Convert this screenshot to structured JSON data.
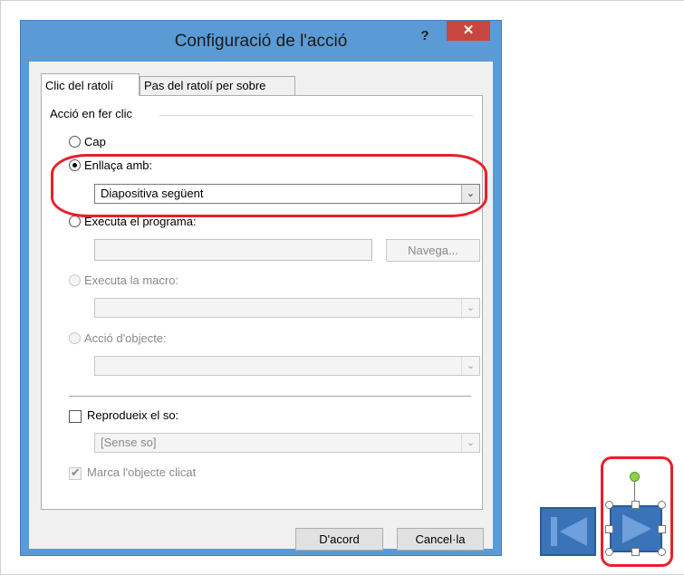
{
  "dialog": {
    "title": "Configuració de l'acció",
    "help_label": "?",
    "close_label": "✕",
    "tabs": [
      {
        "label": "Clic del ratolí"
      },
      {
        "label": "Pas del ratolí per sobre"
      }
    ],
    "group_label": "Acció en fer clic",
    "options": {
      "none": "Cap",
      "link": "Enllaça amb:",
      "link_value": "Diapositiva següent",
      "run_program": "Executa el programa:",
      "browse": "Navega...",
      "run_macro": "Executa la macro:",
      "object_action": "Acció d'objecte:"
    },
    "sound_label": "Reprodueix el so:",
    "sound_value": "[Sense so]",
    "highlight_label": "Marca l'objecte clicat",
    "ok": "D'acord",
    "cancel": "Cancel·la"
  },
  "nav": {
    "back_icon": "skip-back-icon",
    "forward_icon": "play-next-icon"
  },
  "colors": {
    "title_bar": "#5b9bd5",
    "close": "#c7463d",
    "annotation_ring": "#e8202a",
    "nav_button": "#3b73b9"
  }
}
